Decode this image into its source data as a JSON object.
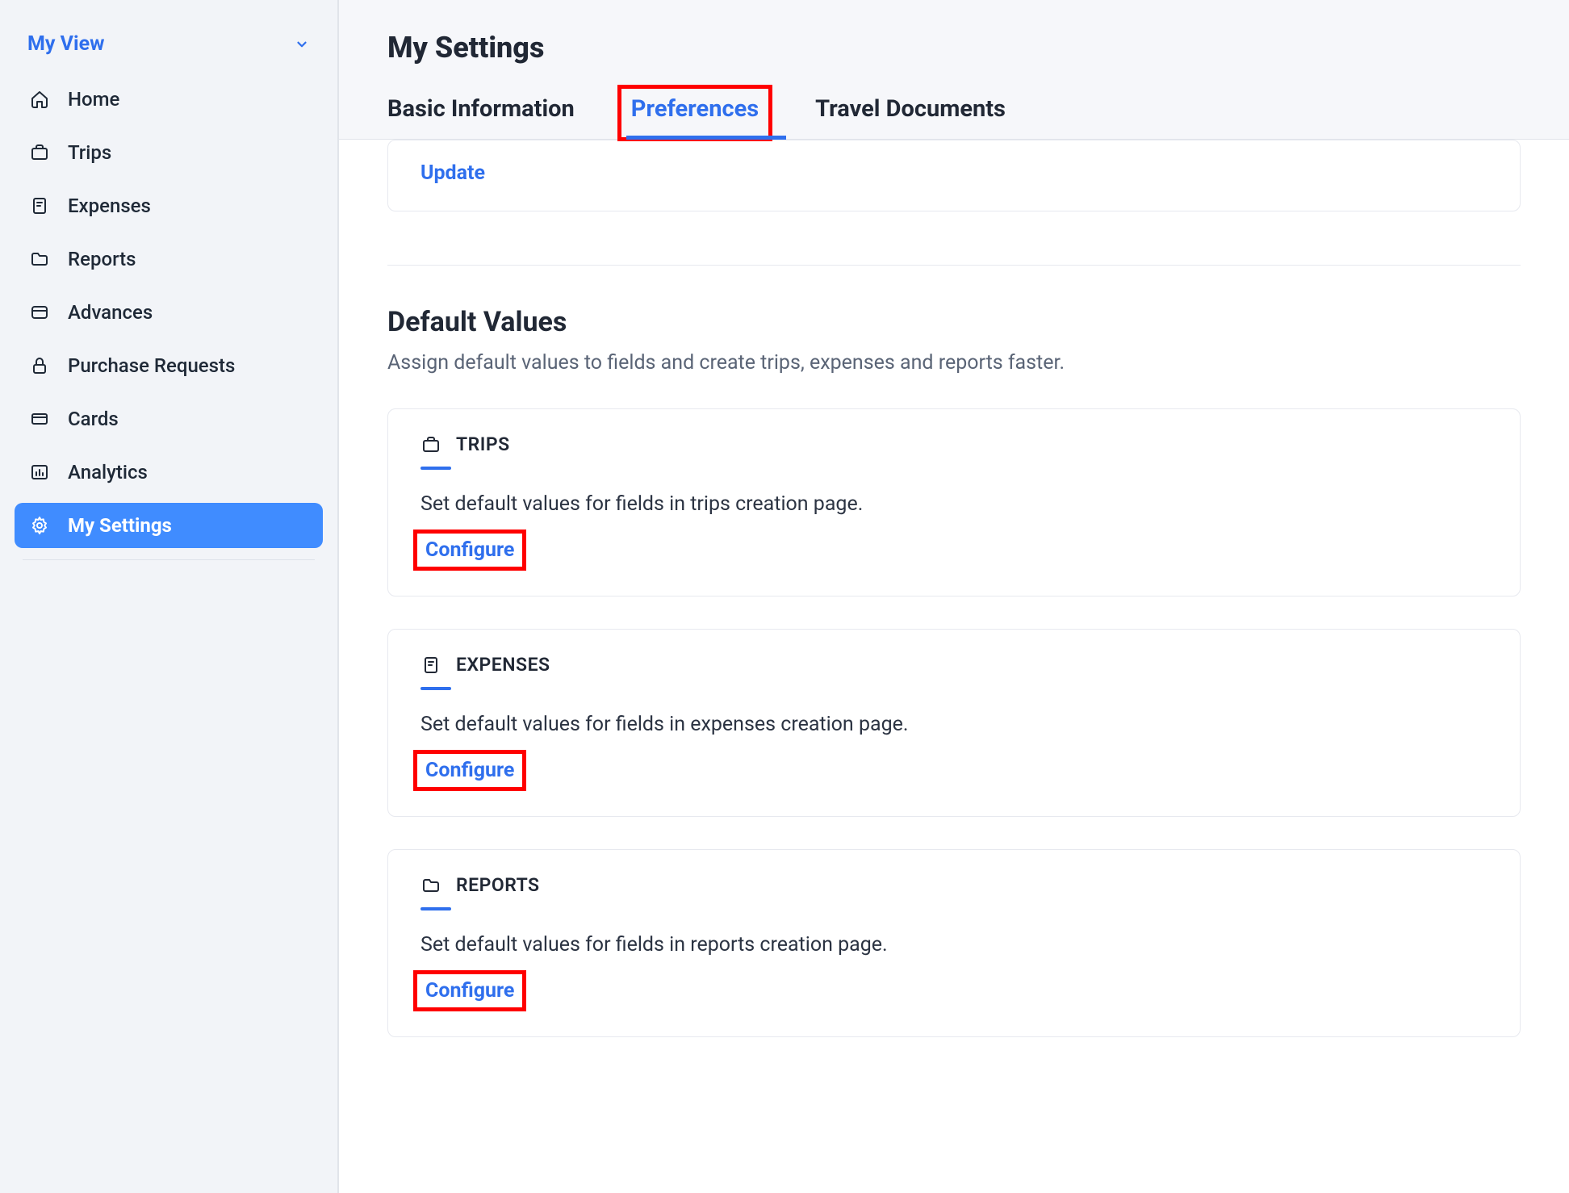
{
  "sidebar": {
    "view_label": "My View",
    "items": [
      {
        "label": "Home",
        "icon": "home-icon"
      },
      {
        "label": "Trips",
        "icon": "briefcase-icon"
      },
      {
        "label": "Expenses",
        "icon": "receipt-icon"
      },
      {
        "label": "Reports",
        "icon": "folder-icon"
      },
      {
        "label": "Advances",
        "icon": "wallet-icon"
      },
      {
        "label": "Purchase Requests",
        "icon": "lock-icon"
      },
      {
        "label": "Cards",
        "icon": "card-icon"
      },
      {
        "label": "Analytics",
        "icon": "analytics-icon"
      },
      {
        "label": "My Settings",
        "icon": "gear-icon",
        "active": true
      }
    ]
  },
  "header": {
    "title": "My Settings",
    "tabs": [
      {
        "label": "Basic Information"
      },
      {
        "label": "Preferences",
        "active": true,
        "highlight": true
      },
      {
        "label": "Travel Documents"
      }
    ]
  },
  "stub_card": {
    "update_label": "Update"
  },
  "default_values": {
    "title": "Default Values",
    "description": "Assign default values to fields and create trips, expenses and reports faster.",
    "cards": [
      {
        "heading": "TRIPS",
        "icon": "briefcase-icon",
        "text": "Set default values for fields in trips creation page.",
        "action": "Configure"
      },
      {
        "heading": "EXPENSES",
        "icon": "receipt-icon",
        "text": "Set default values for fields in expenses creation page.",
        "action": "Configure"
      },
      {
        "heading": "REPORTS",
        "icon": "folder-icon",
        "text": "Set default values for fields in reports creation page.",
        "action": "Configure"
      }
    ]
  }
}
